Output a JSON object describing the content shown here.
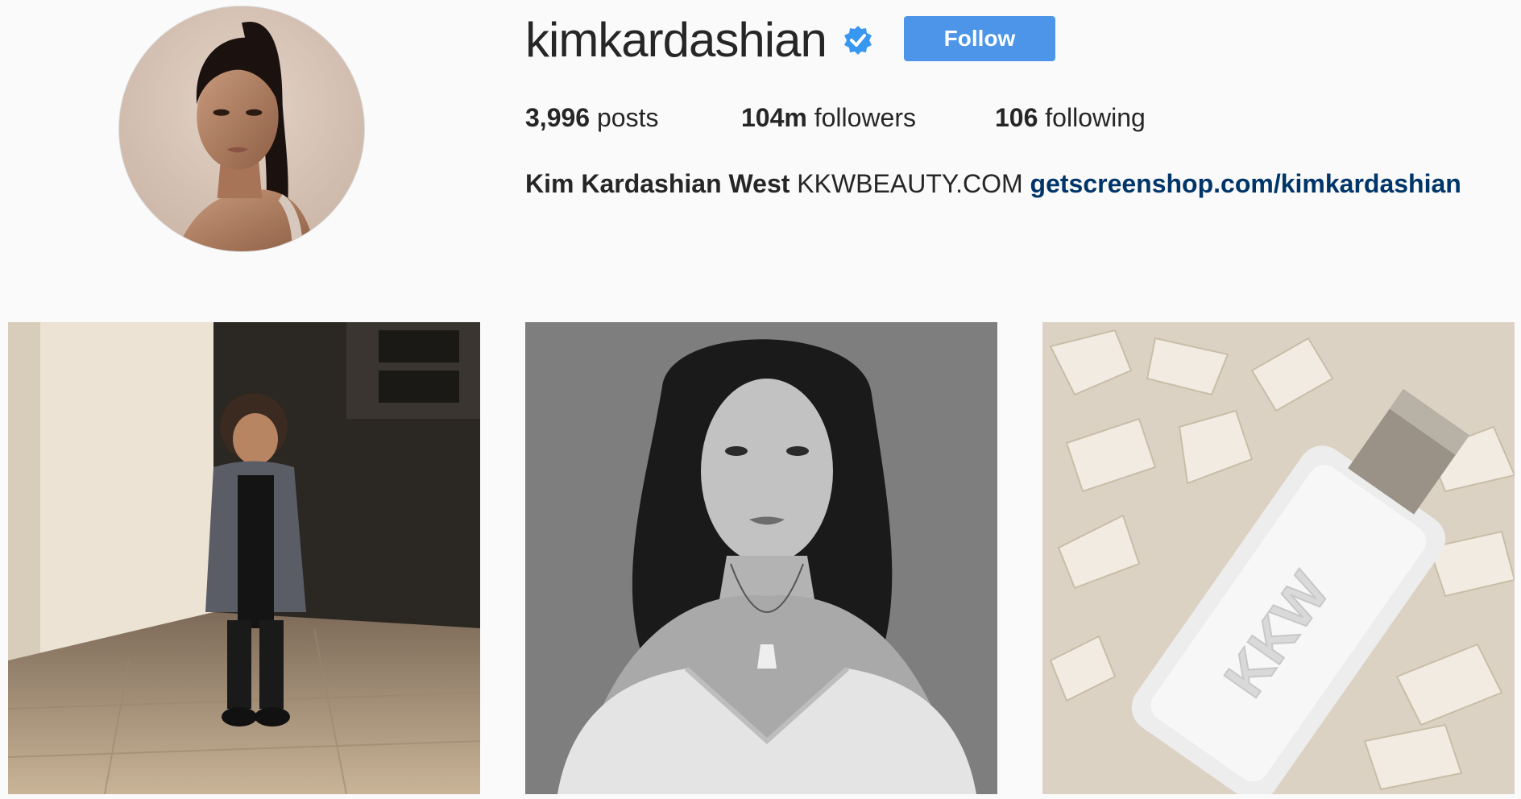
{
  "profile": {
    "username": "kimkardashian",
    "verified": true,
    "follow_label": "Follow",
    "stats": {
      "posts_count": "3,996",
      "posts_label": "posts",
      "followers_count": "104m",
      "followers_label": "followers",
      "following_count": "106",
      "following_label": "following"
    },
    "bio": {
      "name": "Kim Kardashian West",
      "text": "KKWBEAUTY.COM",
      "link": "getscreenshop.com/kimkardashian"
    }
  },
  "posts": [
    {
      "kind": "photo-child-in-hallway"
    },
    {
      "kind": "photo-bw-portrait"
    },
    {
      "kind": "photo-perfume-bottle",
      "bottle_text": "KKW"
    }
  ],
  "colors": {
    "follow_button": "#4c95e8",
    "link": "#003569",
    "verified": "#3897f0",
    "background": "#fafafa"
  }
}
